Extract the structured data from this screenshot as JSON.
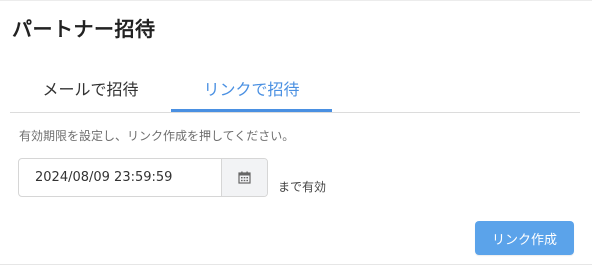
{
  "page": {
    "title": "パートナー招待"
  },
  "tabs": [
    {
      "label": "メールで招待",
      "active": false
    },
    {
      "label": "リンクで招待",
      "active": true
    }
  ],
  "form": {
    "instruction": "有効期限を設定し、リンク作成を押してください。",
    "expiry_value": "2024/08/09 23:59:59",
    "calendar_icon": "calendar-icon",
    "suffix": "まで有効"
  },
  "actions": {
    "create_label": "リンク作成"
  },
  "colors": {
    "accent": "#4a90e2",
    "button": "#5ba3ea"
  }
}
